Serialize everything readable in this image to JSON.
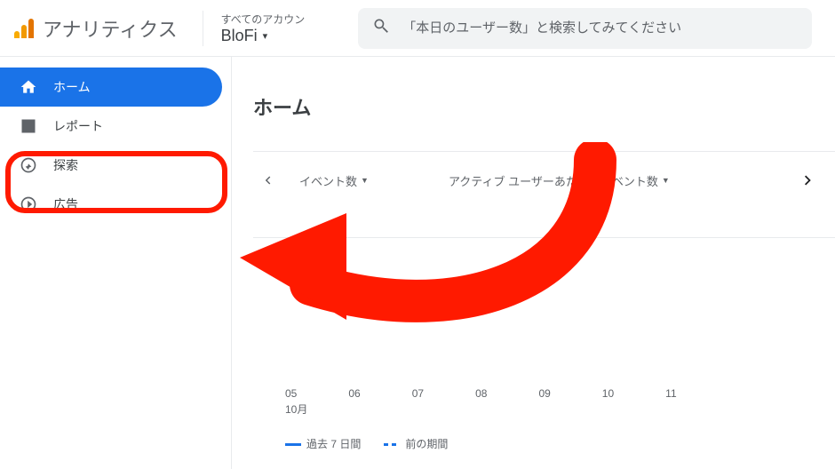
{
  "header": {
    "product_name": "アナリティクス",
    "accounts_label": "すべてのアカウン",
    "property_name": "BloFi"
  },
  "search": {
    "placeholder": "「本日のユーザー数」と検索してみてください"
  },
  "sidebar": {
    "items": [
      {
        "label": "ホーム"
      },
      {
        "label": "レポート"
      },
      {
        "label": "探索"
      },
      {
        "label": "広告"
      }
    ]
  },
  "main": {
    "page_title": "ホーム",
    "metrics": {
      "events": "イベント数",
      "events_per_active_user": "アクティブ ユーザーあたりのイベント数"
    },
    "legend": {
      "current": "過去 7 日間",
      "previous": "前の期間"
    }
  },
  "chart_data": {
    "type": "line",
    "title": "",
    "xlabel": "",
    "ylabel": "",
    "month_label": "10月",
    "categories": [
      "05",
      "06",
      "07",
      "08",
      "09",
      "10",
      "11"
    ],
    "series": [
      {
        "name": "過去 7 日間",
        "values": [
          null,
          null,
          null,
          null,
          null,
          null,
          null
        ]
      },
      {
        "name": "前の期間",
        "values": [
          null,
          null,
          null,
          null,
          null,
          null,
          null
        ]
      }
    ]
  }
}
